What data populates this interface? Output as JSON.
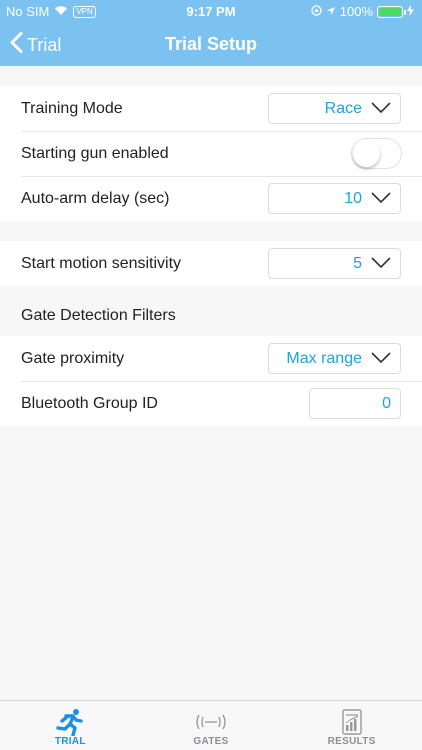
{
  "status_bar": {
    "carrier": "No SIM",
    "vpn": "VPN",
    "time": "9:17 PM",
    "battery": "100%"
  },
  "nav": {
    "back_label": "Trial",
    "title": "Trial Setup"
  },
  "settings": {
    "training_mode": {
      "label": "Training Mode",
      "value": "Race"
    },
    "starting_gun": {
      "label": "Starting gun enabled",
      "enabled": false
    },
    "auto_arm_delay": {
      "label": "Auto-arm delay (sec)",
      "value": "10"
    },
    "start_motion_sensitivity": {
      "label": "Start motion sensitivity",
      "value": "5"
    }
  },
  "gate_filters": {
    "header": "Gate Detection Filters",
    "gate_proximity": {
      "label": "Gate proximity",
      "value": "Max range"
    },
    "bluetooth_group_id": {
      "label": "Bluetooth Group ID",
      "value": "0"
    }
  },
  "tabs": [
    {
      "label": "TRIAL",
      "icon": "runner-icon",
      "active": true
    },
    {
      "label": "GATES",
      "icon": "gates-icon",
      "active": false
    },
    {
      "label": "RESULTS",
      "icon": "results-icon",
      "active": false
    }
  ],
  "colors": {
    "header_blue": "#7cc2f0",
    "accent_blue": "#1aa5e0",
    "tab_active": "#1a8fe3",
    "battery_green": "#4cd964"
  }
}
